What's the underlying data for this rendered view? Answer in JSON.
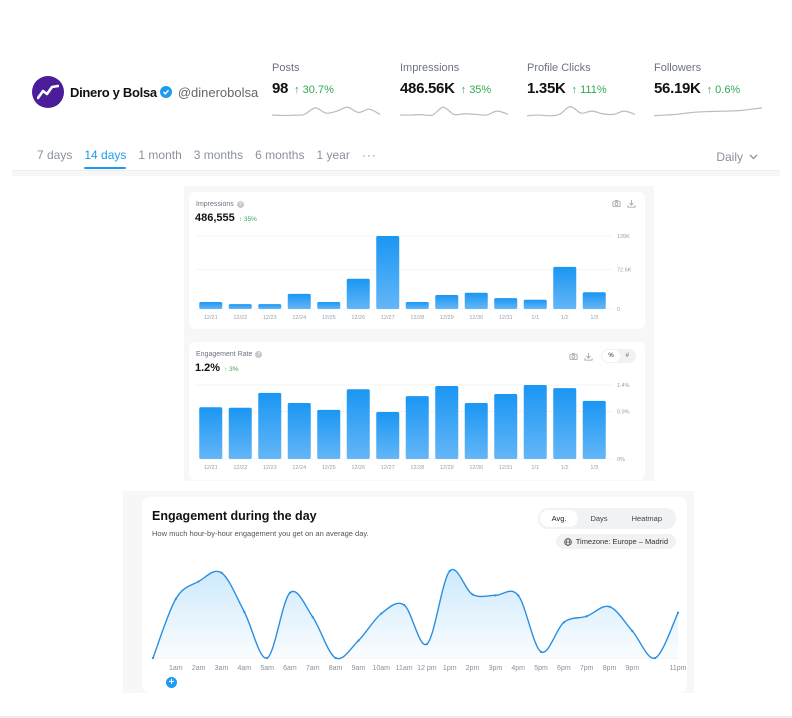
{
  "profile": {
    "name": "Dinero y Bolsa",
    "handle": "@dinerobolsa",
    "avatar_color": "#4b1d9a",
    "verified_color": "#1d9bf0"
  },
  "stats": [
    {
      "label": "Posts",
      "value": "98",
      "change": "30.7%",
      "trend": [
        0.15,
        0.12,
        0.14,
        0.2,
        0.7,
        0.3,
        0.45,
        0.75,
        0.35,
        0.6,
        0.2
      ]
    },
    {
      "label": "Impressions",
      "value": "486.56K",
      "change": "35%",
      "trend": [
        0.15,
        0.15,
        0.18,
        0.15,
        0.75,
        0.2,
        0.25,
        0.2,
        0.15,
        0.45,
        0.2
      ]
    },
    {
      "label": "Profile Clicks",
      "value": "1.35K",
      "change": "111%",
      "trend": [
        0.1,
        0.15,
        0.1,
        0.2,
        0.8,
        0.3,
        0.45,
        0.25,
        0.2,
        0.45,
        0.2
      ]
    },
    {
      "label": "Followers",
      "value": "56.19K",
      "change": "0.6%",
      "trend": [
        0.1,
        0.15,
        0.2,
        0.3,
        0.38,
        0.42,
        0.44,
        0.46,
        0.5,
        0.6,
        0.7
      ]
    }
  ],
  "ranges": {
    "items": [
      "7 days",
      "14 days",
      "1 month",
      "3 months",
      "6 months",
      "1 year",
      "···"
    ],
    "active": "14 days",
    "granularity": "Daily"
  },
  "accent_color": "#1d9bf0",
  "positive_color": "#34a853",
  "chart_data": [
    {
      "type": "bar",
      "title": "Impressions",
      "total": "486,555",
      "change": "35%",
      "categories": [
        "12/21",
        "12/22",
        "12/23",
        "12/24",
        "12/25",
        "12/26",
        "12/27",
        "12/28",
        "12/29",
        "12/30",
        "12/31",
        "1/1",
        "1/2",
        "1/3"
      ],
      "values": [
        13000,
        9000,
        9000,
        28000,
        13000,
        56000,
        135000,
        13000,
        26000,
        30000,
        20000,
        17000,
        78000,
        31000
      ],
      "yticks": [
        0,
        72600,
        135000
      ],
      "ytick_labels": [
        "0",
        "72.6K",
        "135K"
      ],
      "ylim": [
        0,
        135000
      ],
      "grid": true,
      "tools": [
        "camera-icon",
        "download-icon"
      ]
    },
    {
      "type": "bar",
      "title": "Engagement Rate",
      "total": "1.2%",
      "change": "3%",
      "categories": [
        "12/21",
        "12/22",
        "12/23",
        "12/24",
        "12/25",
        "12/26",
        "12/27",
        "12/28",
        "12/29",
        "12/30",
        "12/31",
        "1/1",
        "1/2",
        "1/3"
      ],
      "values": [
        0.98,
        0.97,
        1.25,
        1.06,
        0.93,
        1.32,
        0.89,
        1.19,
        1.38,
        1.06,
        1.23,
        1.4,
        1.34,
        1.1
      ],
      "yticks": [
        0,
        0.9,
        1.4
      ],
      "ytick_labels": [
        "0%",
        "0.9%",
        "1.4%"
      ],
      "ylim": [
        0,
        1.4
      ],
      "grid": true,
      "tools": [
        "camera-icon",
        "download-icon"
      ],
      "toggle": [
        "%",
        "#"
      ],
      "toggle_active": "%"
    },
    {
      "type": "area",
      "title": "Engagement during the day",
      "subtitle": "How much hour-by-hour engagement you get on an average day.",
      "view_options": [
        "Avg.",
        "Days",
        "Heatmap"
      ],
      "view_active": "Avg.",
      "timezone": "Timezone: Europe – Madrid",
      "x_labels": [
        "",
        "1am",
        "2am",
        "3am",
        "4am",
        "5am",
        "6am",
        "7am",
        "8am",
        "9am",
        "10am",
        "11am",
        "12 pm",
        "1pm",
        "2pm",
        "3pm",
        "4pm",
        "5pm",
        "6pm",
        "7pm",
        "8pm",
        "9pm",
        "",
        "11pm"
      ],
      "values": [
        0.0,
        0.68,
        0.88,
        0.98,
        0.53,
        0.0,
        0.75,
        0.47,
        0.0,
        0.2,
        0.51,
        0.61,
        0.16,
        1.0,
        0.73,
        0.72,
        0.72,
        0.07,
        0.41,
        0.48,
        0.59,
        0.31,
        0.0,
        0.52
      ],
      "ylim": [
        0,
        1
      ]
    }
  ]
}
